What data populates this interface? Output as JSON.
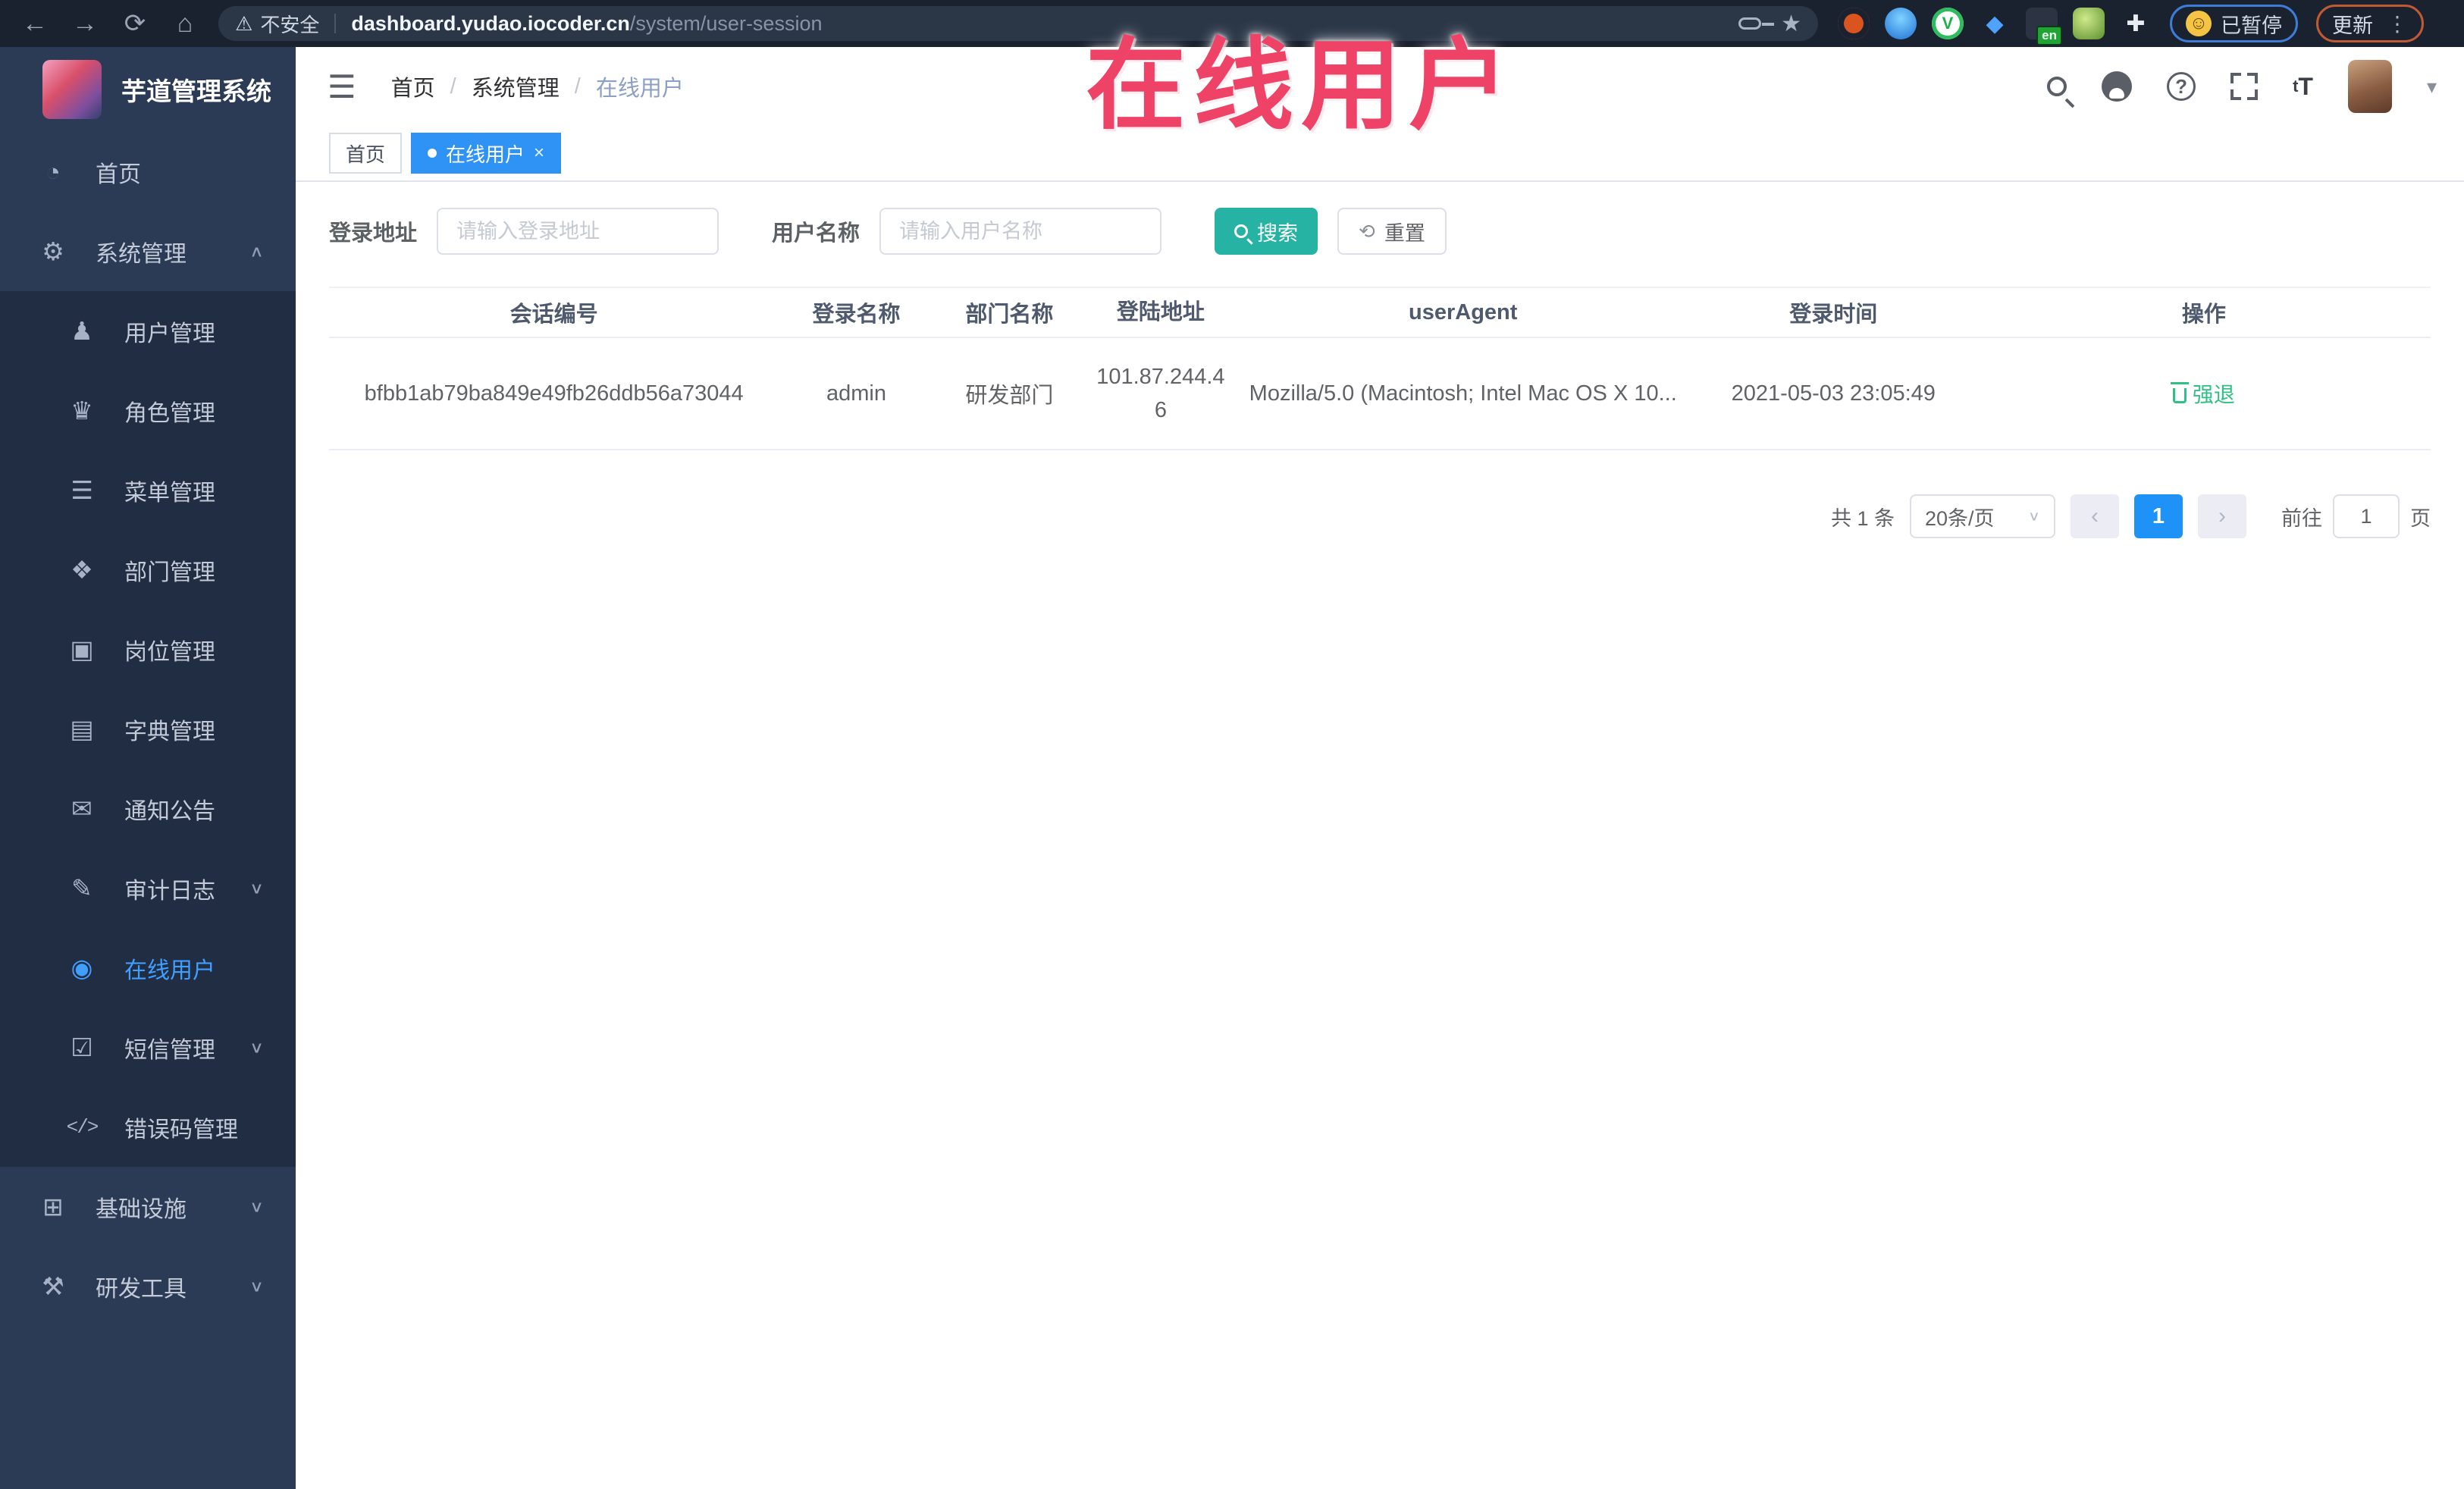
{
  "theme": {
    "accent_blue": "#409eff",
    "teal_button": "#26b3a3",
    "success_green": "#2fc184",
    "sidebar_bg": "#2b3a55",
    "submenu_bg": "#212d42",
    "annotation_red": "#ee4266",
    "chrome_bg": "#1a2230"
  },
  "annotation": {
    "title": "在线用户"
  },
  "browser": {
    "security_label": "不安全",
    "url_domain": "dashboard.yudao.iocoder.cn",
    "url_path": "/system/user-session",
    "paused_badge": "已暂停",
    "update_button": "更新",
    "en_badge": "en",
    "ext3_letter": "V",
    "ext4_glyph": "◆",
    "ext7_glyph": "✚",
    "emoji_glyph": "☺"
  },
  "icons": {
    "back": "←",
    "forward": "→",
    "reload": "⟳",
    "home": "⌂",
    "warning": "⚠",
    "star": "★",
    "hamburger": "☰",
    "caret_down": "▾",
    "chevron_down": "∨",
    "chevron_up": "∧",
    "dots_menu": "⋮",
    "reset": "⟲",
    "prev": "‹",
    "next": "›",
    "dashboard": "◔",
    "system": "⚙",
    "user": "♟",
    "role": "♛",
    "menu": "☰",
    "dept": "❖",
    "post": "▣",
    "dict": "▤",
    "notice": "✉",
    "audit": "✎",
    "online": "◉",
    "sms": "☑",
    "errcode": "</>",
    "infra": "⊞",
    "tools": "⚒",
    "fontsize_big": "T",
    "fontsize_small": "t"
  },
  "sidebar": {
    "app_title": "芋道管理系统",
    "items": [
      {
        "label": "首页"
      },
      {
        "label": "系统管理"
      },
      {
        "label": "用户管理"
      },
      {
        "label": "角色管理"
      },
      {
        "label": "菜单管理"
      },
      {
        "label": "部门管理"
      },
      {
        "label": "岗位管理"
      },
      {
        "label": "字典管理"
      },
      {
        "label": "通知公告"
      },
      {
        "label": "审计日志"
      },
      {
        "label": "在线用户"
      },
      {
        "label": "短信管理"
      },
      {
        "label": "错误码管理"
      },
      {
        "label": "基础设施"
      },
      {
        "label": "研发工具"
      }
    ]
  },
  "header": {
    "breadcrumb": [
      {
        "label": "首页"
      },
      {
        "label": "系统管理"
      },
      {
        "label": "在线用户"
      }
    ],
    "separator": "/"
  },
  "tabs": [
    {
      "label": "首页"
    },
    {
      "label": "在线用户",
      "close": "×"
    }
  ],
  "filters": {
    "login_address_label": "登录地址",
    "login_address_placeholder": "请输入登录地址",
    "username_label": "用户名称",
    "username_placeholder": "请输入用户名称",
    "search_label": "搜索",
    "reset_label": "重置"
  },
  "table": {
    "columns": [
      {
        "label": "会话编号"
      },
      {
        "label": "登录名称"
      },
      {
        "label": "部门名称"
      },
      {
        "label": "登陆地址"
      },
      {
        "label": "userAgent"
      },
      {
        "label": "登录时间"
      },
      {
        "label": "操作"
      }
    ],
    "rows": [
      {
        "session_id": "bfbb1ab79ba849e49fb26ddb56a73044",
        "username": "admin",
        "dept": "研发部门",
        "ip": "101.87.244.46",
        "user_agent": "Mozilla/5.0 (Macintosh; Intel Mac OS X 10...",
        "login_time": "2021-05-03 23:05:49",
        "action": "强退"
      }
    ]
  },
  "pagination": {
    "total_label": "共 1 条",
    "page_size": "20条/页",
    "current_page": "1",
    "goto_label": "前往",
    "goto_value": "1",
    "page_unit": "页"
  }
}
